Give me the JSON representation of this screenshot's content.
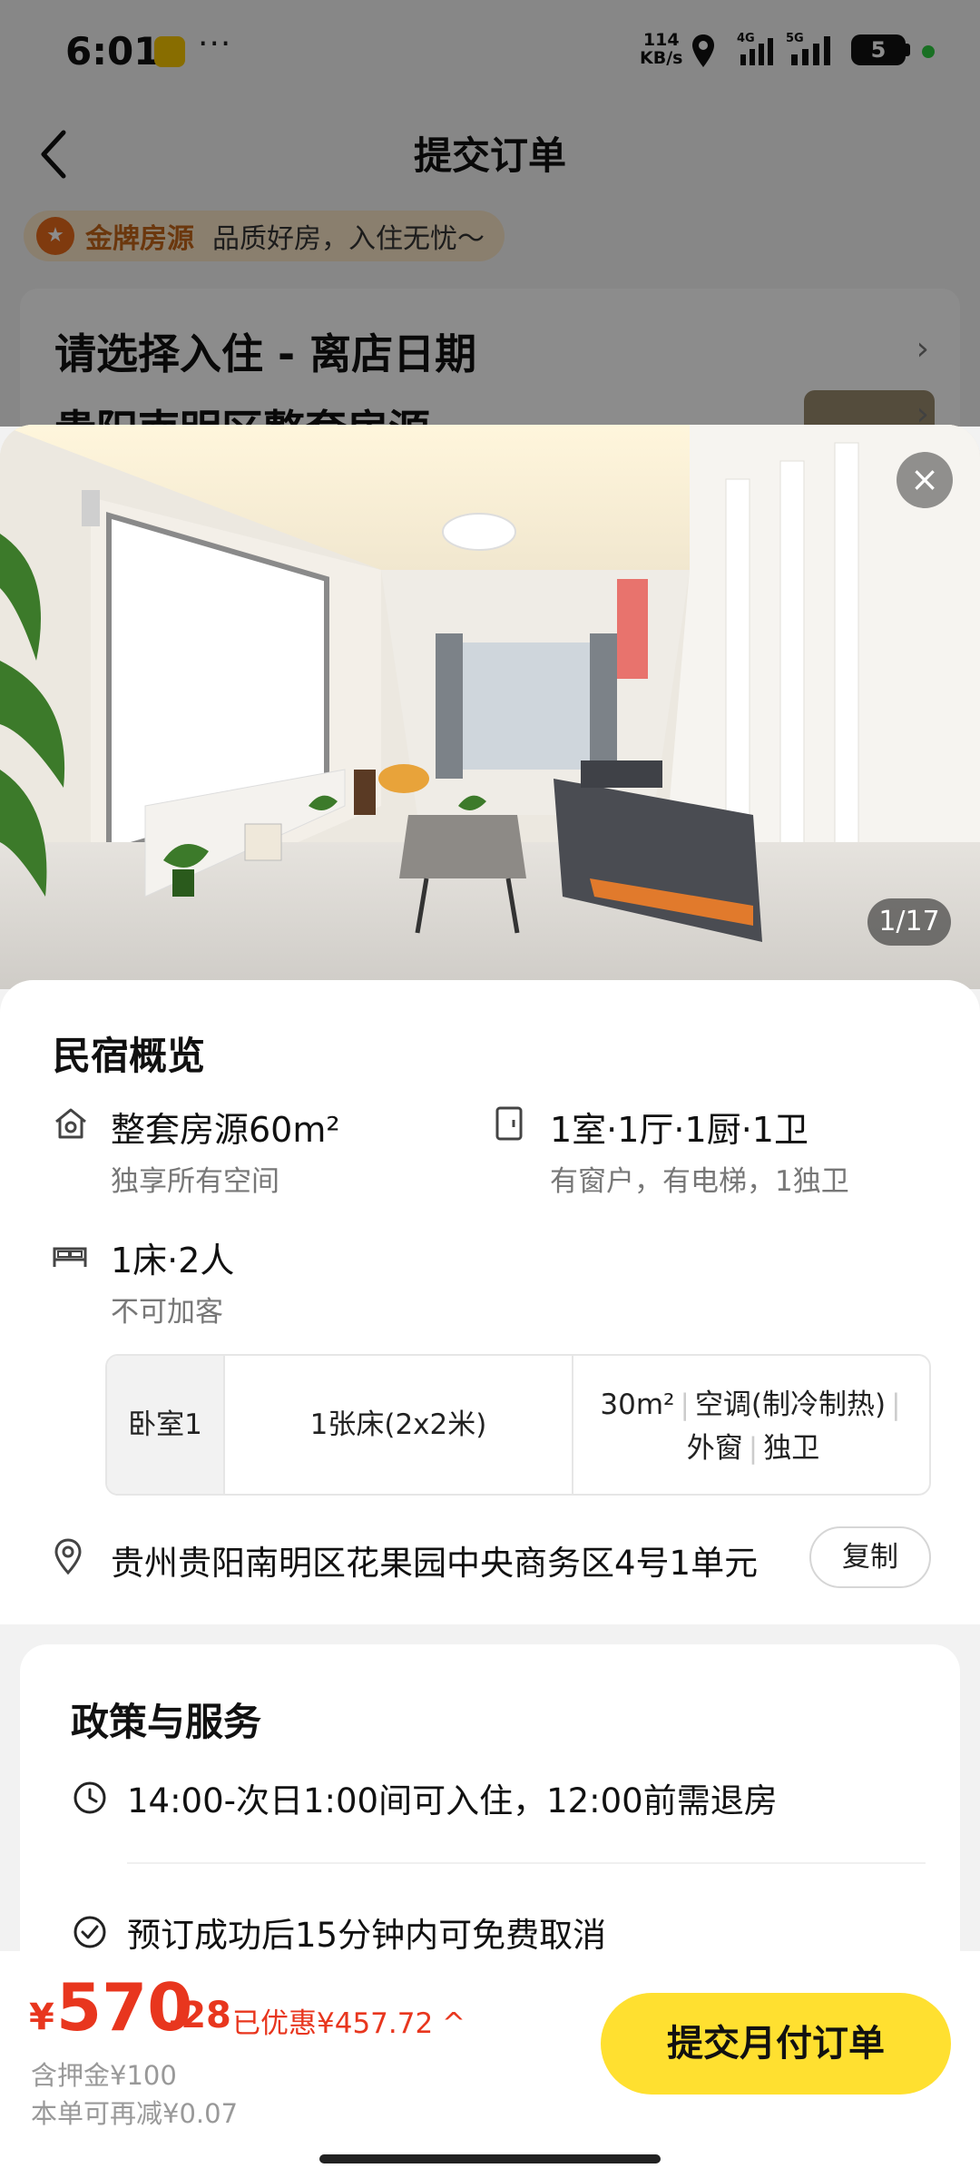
{
  "status_bar": {
    "time": "6:01",
    "dots": "···",
    "net_speed_top": "114",
    "net_speed_unit": "KB/s",
    "sig1": "4G",
    "sig2": "5G",
    "battery": "5"
  },
  "nav": {
    "title": "提交订单"
  },
  "gold": {
    "label": "金牌房源",
    "text": "品质好房，入住无忧～"
  },
  "date_card": {
    "title": "请选择入住 - 离店日期",
    "house": "贵阳南明区整套房源"
  },
  "photo": {
    "counter": "1/17"
  },
  "overview": {
    "title": "民宿概览",
    "f1_main": "整套房源60m²",
    "f1_sub": "独享所有空间",
    "f2_main": "1室·1厅·1厨·1卫",
    "f2_sub": "有窗户，有电梯，1独卫",
    "f3_main": "1床·2人",
    "f3_sub": "不可加客",
    "room": {
      "name": "卧室1",
      "bed": "1张床(2x2米)",
      "area": "30m²",
      "ac": "空调(制冷制热)",
      "window": "外窗",
      "bath": "独卫"
    },
    "address": "贵州贵阳南明区花果园中央商务区4号1单元",
    "copy_label": "复制"
  },
  "policy": {
    "title": "政策与服务",
    "checkin": "14:00-次日1:00间可入住，12:00前需退房",
    "cancel": "预订成功后15分钟内可免费取消"
  },
  "bottom": {
    "yen": "¥",
    "price_int": "570",
    "price_dec": ".28",
    "saved": "已优惠¥457.72 ^",
    "deposit": "含押金¥100",
    "reduce": "本单可再减¥0.07",
    "submit_label": "提交月付订单"
  }
}
